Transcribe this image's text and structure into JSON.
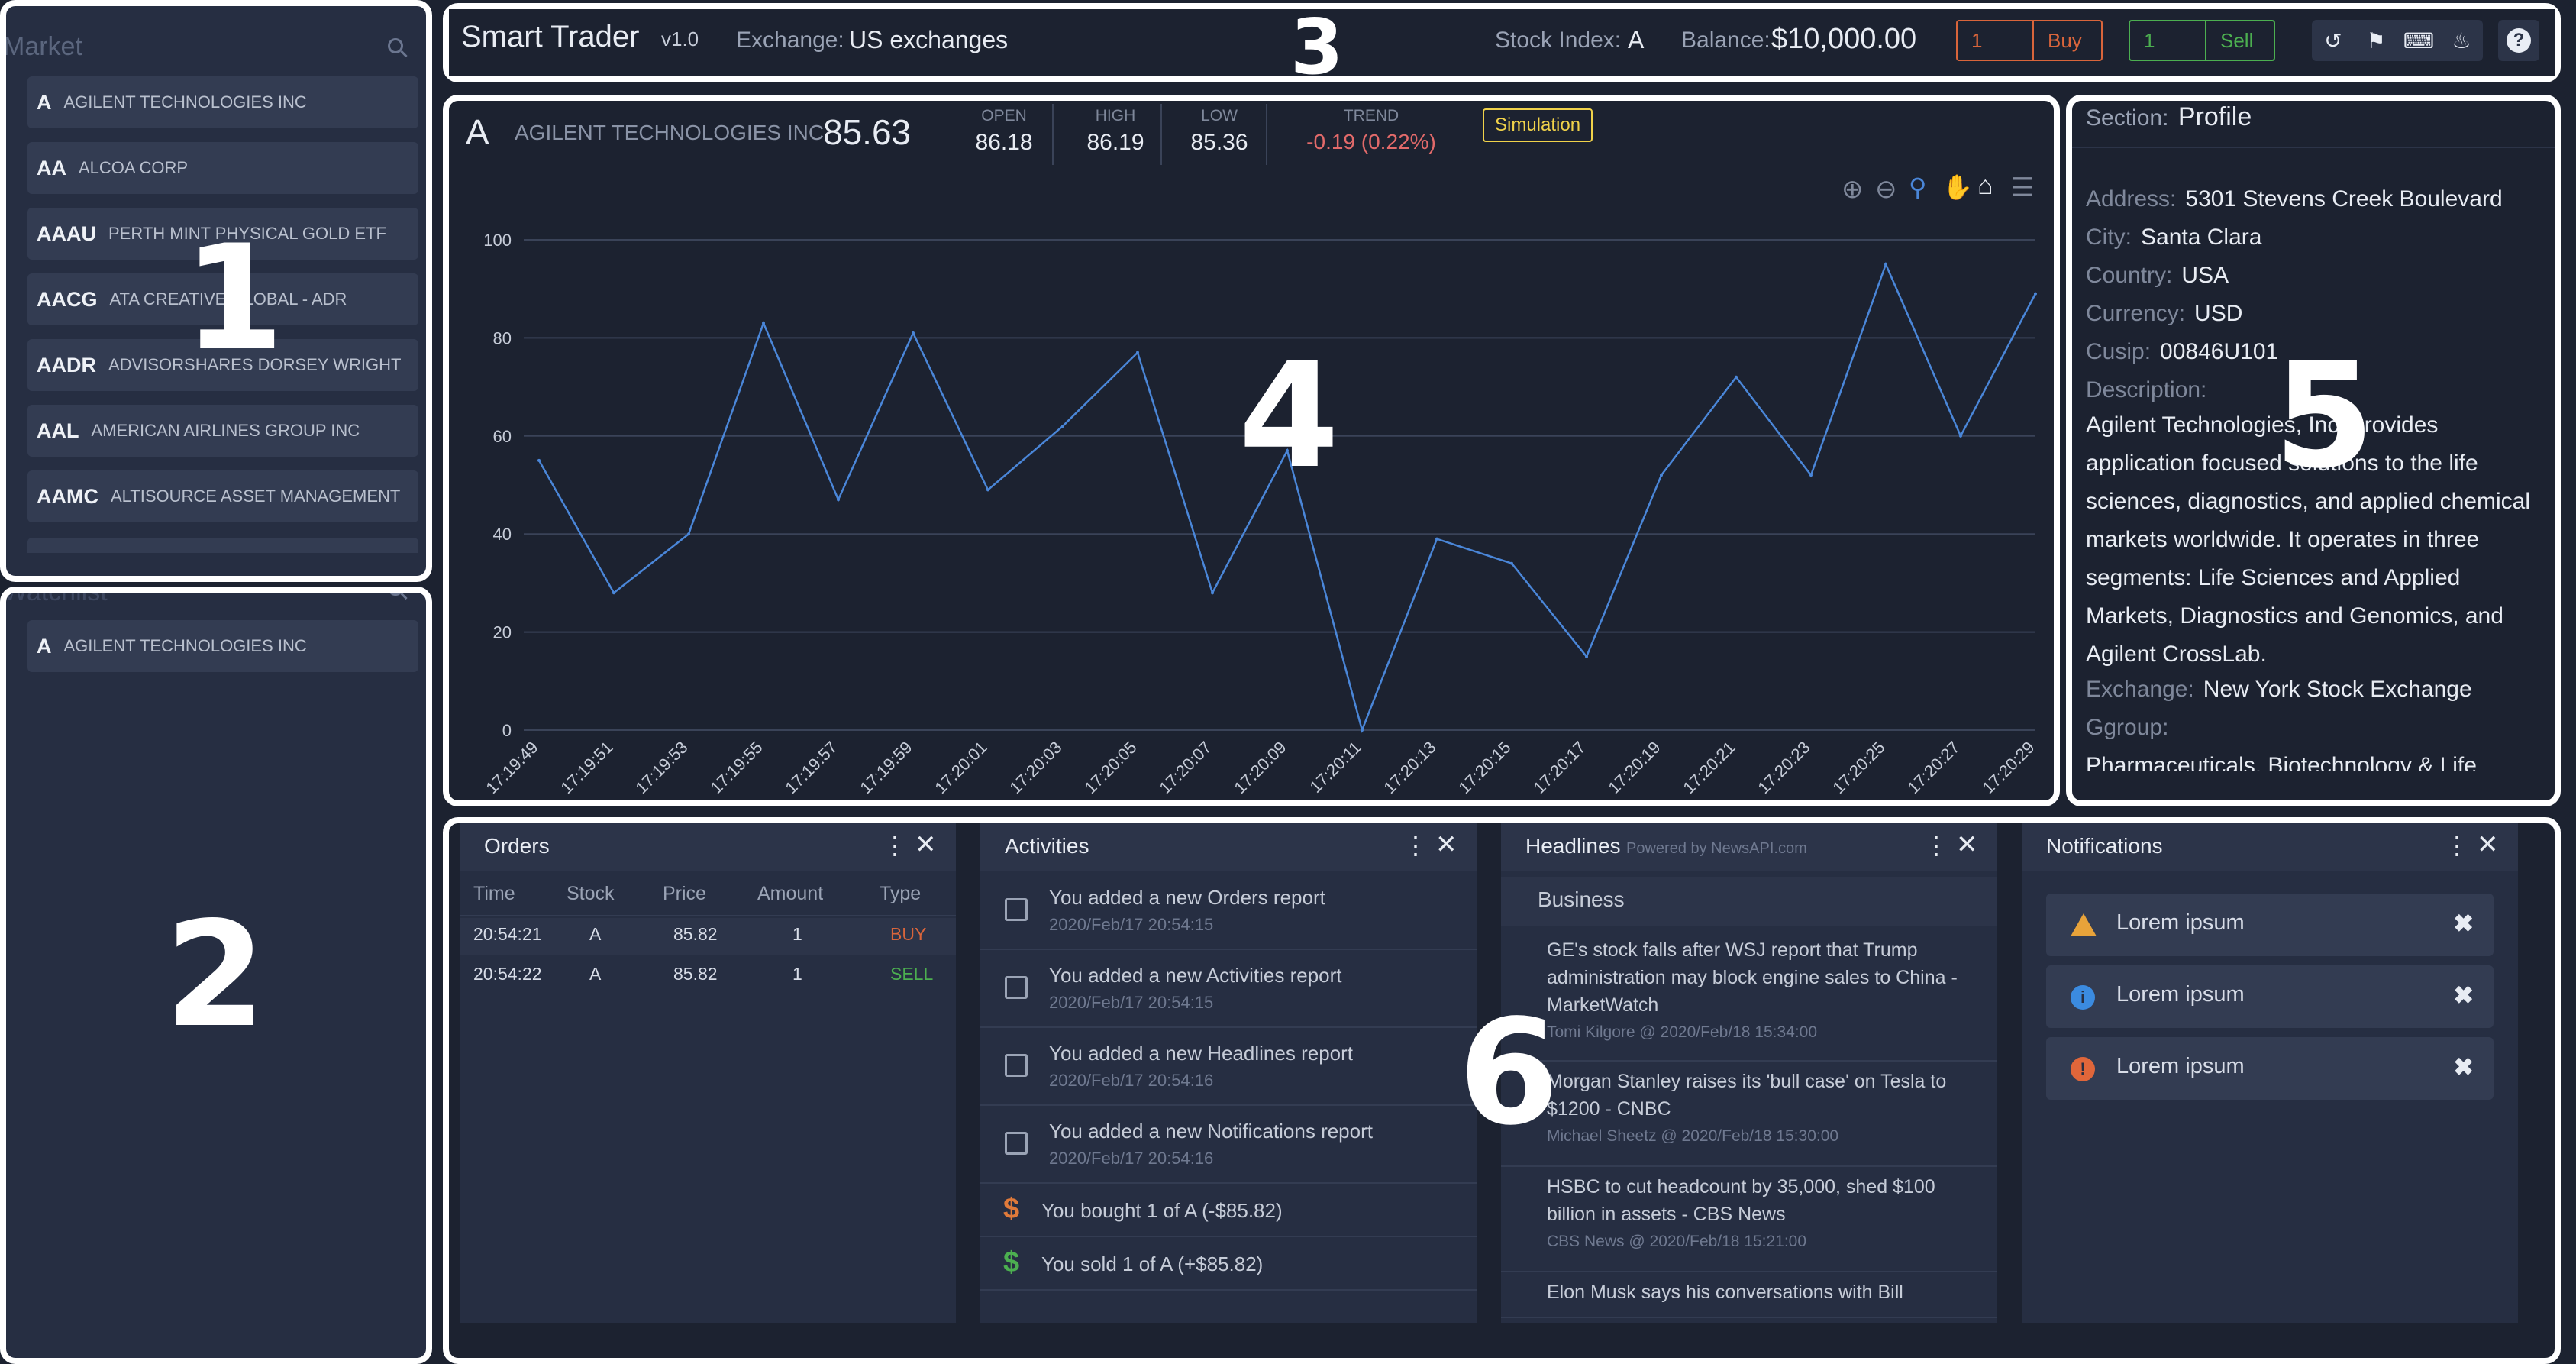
{
  "market": {
    "title": "Market",
    "items": [
      {
        "symbol": "A",
        "name": "AGILENT TECHNOLOGIES INC"
      },
      {
        "symbol": "AA",
        "name": "ALCOA CORP"
      },
      {
        "symbol": "AAAU",
        "name": "PERTH MINT PHYSICAL GOLD ETF"
      },
      {
        "symbol": "AACG",
        "name": "ATA CREATIVE GLOBAL - ADR"
      },
      {
        "symbol": "AADR",
        "name": "ADVISORSHARES DORSEY WRIGHT"
      },
      {
        "symbol": "AAL",
        "name": "AMERICAN AIRLINES GROUP INC"
      },
      {
        "symbol": "AAMC",
        "name": "ALTISOURCE ASSET MANAGEMENT"
      }
    ]
  },
  "watchlist": {
    "title": "Watchlist",
    "items": [
      {
        "symbol": "A",
        "name": "AGILENT TECHNOLOGIES INC"
      }
    ]
  },
  "region_labels": [
    "1",
    "2",
    "3",
    "4",
    "5",
    "6"
  ],
  "topbar": {
    "app_title": "Smart Trader",
    "version": "v1.0",
    "exchange_label": "Exchange:",
    "exchange_value": "US exchanges",
    "index_label": "Stock Index:",
    "index_value": "A",
    "balance_label": "Balance:",
    "balance_value": "$10,000.00",
    "buy_qty": "1",
    "buy_label": "Buy",
    "sell_qty": "1",
    "sell_label": "Sell",
    "icons": [
      "history-icon",
      "flag-icon",
      "keyboard-icon",
      "bell-icon",
      "help-icon"
    ],
    "buy_color": "#d9653b",
    "sell_color": "#4caf50"
  },
  "quote": {
    "symbol": "A",
    "name": "AGILENT TECHNOLOGIES INC",
    "price": "85.63",
    "open_label": "OPEN",
    "open": "86.18",
    "high_label": "HIGH",
    "high": "86.19",
    "low_label": "LOW",
    "low": "85.36",
    "trend_label": "TREND",
    "trend": "-0.19 (0.22%)",
    "mode_badge": "Simulation"
  },
  "chart_data": {
    "type": "line",
    "x": [
      "17:19:49",
      "17:19:51",
      "17:19:53",
      "17:19:55",
      "17:19:57",
      "17:19:59",
      "17:20:01",
      "17:20:03",
      "17:20:05",
      "17:20:07",
      "17:20:09",
      "17:20:11",
      "17:20:13",
      "17:20:15",
      "17:20:17",
      "17:20:19",
      "17:20:21",
      "17:20:23",
      "17:20:25",
      "17:20:27",
      "17:20:29"
    ],
    "series": [
      {
        "values": [
          55,
          28,
          40,
          83,
          47,
          81,
          49,
          62,
          77,
          28,
          57,
          0,
          39,
          34,
          15,
          52,
          72,
          52,
          95,
          60,
          89
        ]
      }
    ],
    "ylim": [
      0,
      100
    ],
    "yticks": [
      0,
      20,
      40,
      60,
      80,
      100
    ],
    "grid": true,
    "line_color": "#4a86d8",
    "toolbar_icons": [
      "zoom-in-icon",
      "zoom-out-icon",
      "zoom-select-icon",
      "pan-icon",
      "home-icon",
      "menu-icon"
    ]
  },
  "profile": {
    "section_label": "Section:",
    "section_value": "Profile",
    "address_label": "Address:",
    "address": "5301 Stevens Creek Boulevard",
    "city_label": "City:",
    "city": "Santa Clara",
    "country_label": "Country:",
    "country": "USA",
    "currency_label": "Currency:",
    "currency": "USD",
    "cusip_label": "Cusip:",
    "cusip": "00846U101",
    "description_label": "Description:",
    "description": "Agilent Technologies, Inc. provides application focused solutions to the life sciences, diagnostics, and applied chemical markets worldwide. It operates in three segments: Life Sciences and Applied Markets, Diagnostics and Genomics, and Agilent CrossLab.",
    "exchange_label": "Exchange:",
    "exchange": "New York Stock Exchange",
    "group_label": "Ggroup:",
    "group": "Pharmaceuticals, Biotechnology & Life"
  },
  "orders": {
    "title": "Orders",
    "columns": [
      "Time",
      "Stock",
      "Price",
      "Amount",
      "Type"
    ],
    "rows": [
      {
        "time": "20:54:21",
        "stock": "A",
        "price": "85.82",
        "amount": "1",
        "type": "BUY"
      },
      {
        "time": "20:54:22",
        "stock": "A",
        "price": "85.82",
        "amount": "1",
        "type": "SELL"
      }
    ]
  },
  "activities": {
    "title": "Activities",
    "items": [
      {
        "text": "You added a new Orders report",
        "date": "2020/Feb/17 20:54:15"
      },
      {
        "text": "You added a new Activities report",
        "date": "2020/Feb/17 20:54:15"
      },
      {
        "text": "You added a new Headlines report",
        "date": "2020/Feb/17 20:54:16"
      },
      {
        "text": "You added a new Notifications report",
        "date": "2020/Feb/17 20:54:16"
      }
    ],
    "trades": [
      {
        "text": "You bought 1 of A (-$85.82)",
        "color": "#e07a3a"
      },
      {
        "text": "You sold 1 of A (+$85.82)",
        "color": "#4caf50"
      }
    ]
  },
  "headlines": {
    "title": "Headlines",
    "powered": "Powered by NewsAPI.com",
    "category": "Business",
    "items": [
      {
        "title": "GE's stock falls after WSJ report that Trump administration may block engine sales to China - MarketWatch",
        "meta": "Tomi Kilgore @ 2020/Feb/18 15:34:00"
      },
      {
        "title": "Morgan Stanley raises its 'bull case' on Tesla to $1200 - CNBC",
        "meta": "Michael Sheetz @ 2020/Feb/18 15:30:00"
      },
      {
        "title": "HSBC to cut headcount by 35,000, shed $100 billion in assets - CBS News",
        "meta": "CBS News @ 2020/Feb/18 15:21:00"
      },
      {
        "title": "Elon Musk says his conversations with Bill",
        "meta": ""
      }
    ]
  },
  "notifications": {
    "title": "Notifications",
    "items": [
      {
        "text": "Lorem ipsum",
        "icon": "warning-icon",
        "color": "#e8a33a"
      },
      {
        "text": "Lorem ipsum",
        "icon": "info-icon",
        "color": "#3b8be0"
      },
      {
        "text": "Lorem ipsum",
        "icon": "error-icon",
        "color": "#e0663a"
      }
    ]
  }
}
